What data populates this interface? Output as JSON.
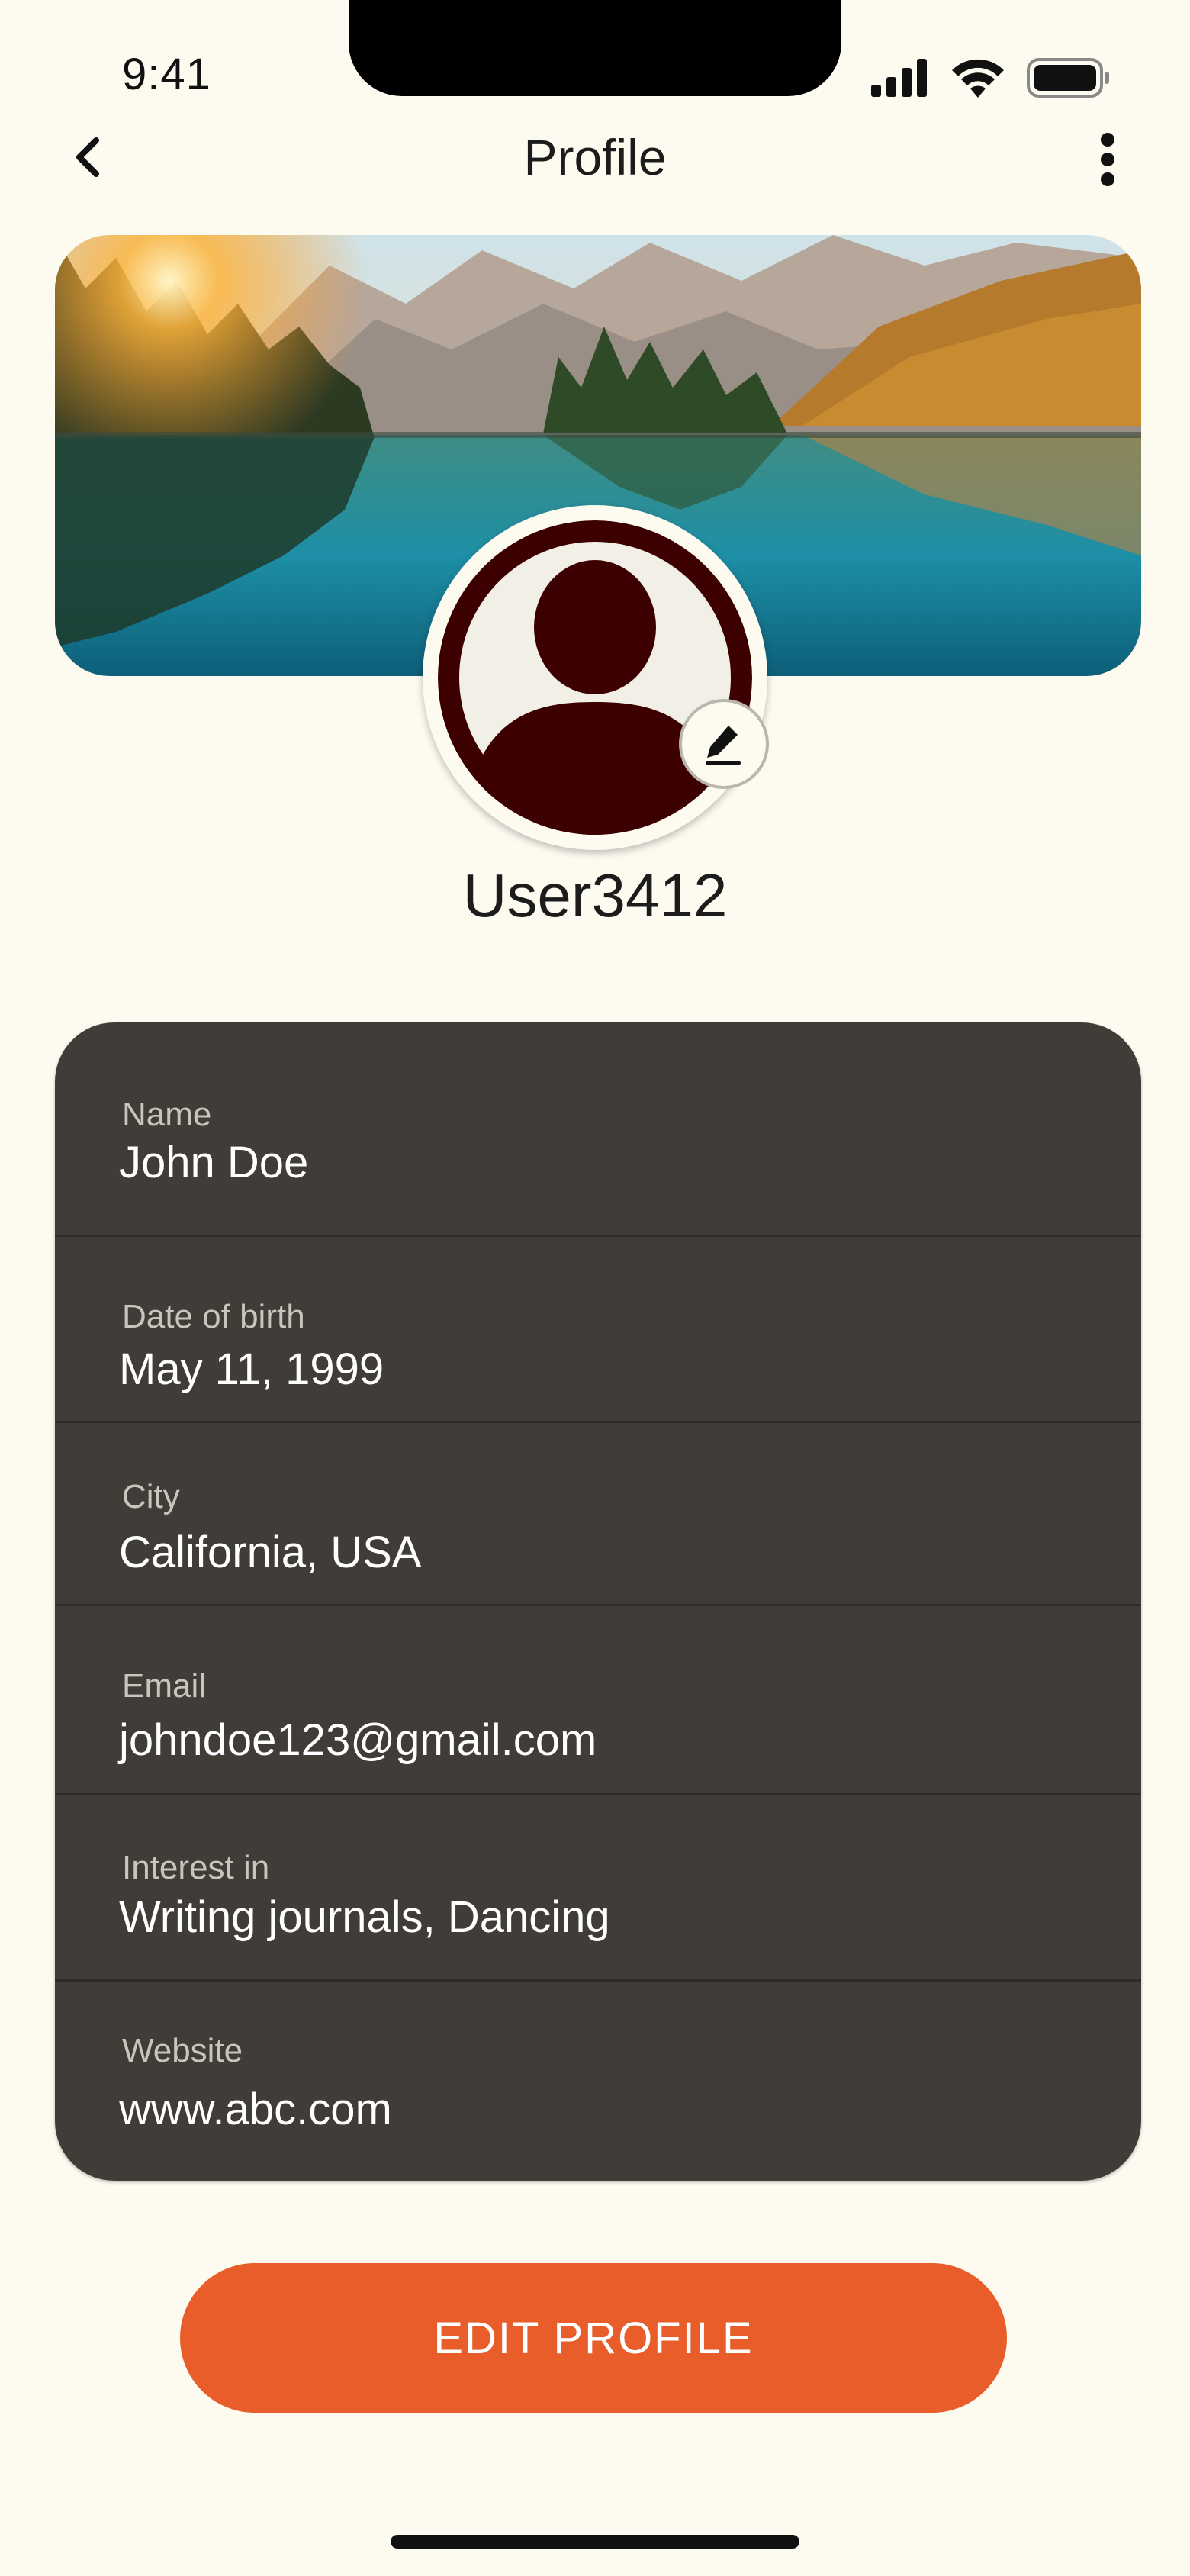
{
  "status_bar": {
    "time": "9:41"
  },
  "nav": {
    "title": "Profile",
    "back_icon": "chevron-left-icon",
    "more_icon": "vertical-dots-icon"
  },
  "profile": {
    "username": "User3412"
  },
  "fields": [
    {
      "label": "Name",
      "value": "John Doe"
    },
    {
      "label": "Date of birth",
      "value": "May 11, 1999"
    },
    {
      "label": "City",
      "value": "California, USA"
    },
    {
      "label": "Email",
      "value": "johndoe123@gmail.com"
    },
    {
      "label": "Interest in",
      "value": "Writing journals, Dancing"
    },
    {
      "label": "Website",
      "value": "www.abc.com"
    }
  ],
  "actions": {
    "edit_profile_label": "EDIT PROFILE"
  },
  "colors": {
    "background": "#fdfbf0",
    "card": "#403c38",
    "accent": "#e85d2a",
    "avatar": "#3d0000"
  }
}
